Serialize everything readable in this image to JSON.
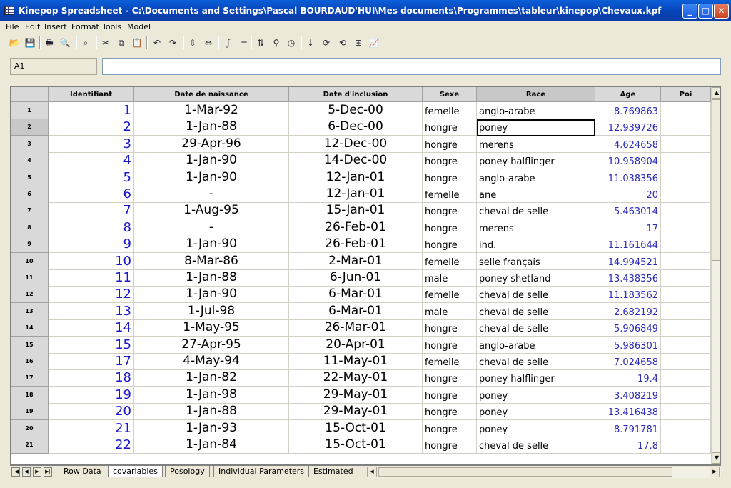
{
  "window": {
    "title": "Kinepop Spreadsheet - C:\\Documents and Settings\\Pascal BOURDAUD'HUI\\Mes documents\\Programmes\\tableur\\kinepop\\Chevaux.kpf",
    "minimize": "_",
    "maximize": "□",
    "close": "✕"
  },
  "menu": [
    "File",
    "Edit",
    "Insert",
    "Format",
    "Tools",
    "Model"
  ],
  "toolbar": [
    {
      "name": "open-icon",
      "glyph": "📂"
    },
    {
      "name": "save-icon",
      "glyph": "💾"
    },
    {
      "name": "print-icon",
      "glyph": "🖶"
    },
    {
      "name": "print-preview-icon",
      "glyph": "🔍"
    },
    {
      "name": "find-icon",
      "glyph": "⌕"
    },
    {
      "name": "cut-icon",
      "glyph": "✂"
    },
    {
      "name": "copy-icon",
      "glyph": "⧉"
    },
    {
      "name": "paste-icon",
      "glyph": "📋"
    },
    {
      "name": "undo-icon",
      "glyph": "↶"
    },
    {
      "name": "redo-icon",
      "glyph": "↷"
    },
    {
      "name": "insert-rows-icon",
      "glyph": "⇳"
    },
    {
      "name": "insert-columns-icon",
      "glyph": "⇔"
    },
    {
      "name": "function-icon",
      "glyph": "ƒ"
    },
    {
      "name": "equals-icon",
      "glyph": "="
    },
    {
      "name": "sort-icon",
      "glyph": "⇅"
    },
    {
      "name": "filter-icon",
      "glyph": "⚲"
    },
    {
      "name": "clock-icon",
      "glyph": "◷"
    },
    {
      "name": "sort-asc-icon",
      "glyph": "↓"
    },
    {
      "name": "rotate-icon",
      "glyph": "⟳"
    },
    {
      "name": "rotate-back-icon",
      "glyph": "⟲"
    },
    {
      "name": "grid-icon",
      "glyph": "⊞"
    },
    {
      "name": "chart-icon",
      "glyph": "📈"
    }
  ],
  "cell_ref": "A1",
  "formula_value": "",
  "columns": {
    "id": "Identifiant",
    "birth": "Date de naissance",
    "inclusion": "Date d'inclusion",
    "sexe": "Sexe",
    "race": "Race",
    "age": "Age",
    "po": "Poi"
  },
  "rows": [
    {
      "n": "1",
      "id": "1",
      "birth": "1-Mar-92",
      "inclusion": "5-Dec-00",
      "sexe": "femelle",
      "race": "anglo-arabe",
      "age": "8.769863"
    },
    {
      "n": "2",
      "id": "2",
      "birth": "1-Jan-88",
      "inclusion": "6-Dec-00",
      "sexe": "hongre",
      "race": "poney",
      "age": "12.939726"
    },
    {
      "n": "3",
      "id": "3",
      "birth": "29-Apr-96",
      "inclusion": "12-Dec-00",
      "sexe": "hongre",
      "race": "merens",
      "age": "4.624658"
    },
    {
      "n": "4",
      "id": "4",
      "birth": "1-Jan-90",
      "inclusion": "14-Dec-00",
      "sexe": "hongre",
      "race": "poney halflinger",
      "age": "10.958904"
    },
    {
      "n": "5",
      "id": "5",
      "birth": "1-Jan-90",
      "inclusion": "12-Jan-01",
      "sexe": "hongre",
      "race": "anglo-arabe",
      "age": "11.038356"
    },
    {
      "n": "6",
      "id": "6",
      "birth": "-",
      "inclusion": "12-Jan-01",
      "sexe": "femelle",
      "race": "ane",
      "age": "20"
    },
    {
      "n": "7",
      "id": "7",
      "birth": "1-Aug-95",
      "inclusion": "15-Jan-01",
      "sexe": "hongre",
      "race": "cheval de selle",
      "age": "5.463014"
    },
    {
      "n": "8",
      "id": "8",
      "birth": "-",
      "inclusion": "26-Feb-01",
      "sexe": "hongre",
      "race": "merens",
      "age": "17"
    },
    {
      "n": "9",
      "id": "9",
      "birth": "1-Jan-90",
      "inclusion": "26-Feb-01",
      "sexe": "hongre",
      "race": "ind.",
      "age": "11.161644"
    },
    {
      "n": "10",
      "id": "10",
      "birth": "8-Mar-86",
      "inclusion": "2-Mar-01",
      "sexe": "femelle",
      "race": "selle français",
      "age": "14.994521"
    },
    {
      "n": "11",
      "id": "11",
      "birth": "1-Jan-88",
      "inclusion": "6-Jun-01",
      "sexe": "male",
      "race": "poney shetland",
      "age": "13.438356"
    },
    {
      "n": "12",
      "id": "12",
      "birth": "1-Jan-90",
      "inclusion": "6-Mar-01",
      "sexe": "femelle",
      "race": "cheval de selle",
      "age": "11.183562"
    },
    {
      "n": "13",
      "id": "13",
      "birth": "1-Jul-98",
      "inclusion": "6-Mar-01",
      "sexe": "male",
      "race": "cheval de selle",
      "age": "2.682192"
    },
    {
      "n": "14",
      "id": "14",
      "birth": "1-May-95",
      "inclusion": "26-Mar-01",
      "sexe": "hongre",
      "race": "cheval de selle",
      "age": "5.906849"
    },
    {
      "n": "15",
      "id": "15",
      "birth": "27-Apr-95",
      "inclusion": "20-Apr-01",
      "sexe": "hongre",
      "race": "anglo-arabe",
      "age": "5.986301"
    },
    {
      "n": "16",
      "id": "17",
      "birth": "4-May-94",
      "inclusion": "11-May-01",
      "sexe": "femelle",
      "race": "cheval de selle",
      "age": "7.024658"
    },
    {
      "n": "17",
      "id": "18",
      "birth": "1-Jan-82",
      "inclusion": "22-May-01",
      "sexe": "hongre",
      "race": "poney halflinger",
      "age": "19.4"
    },
    {
      "n": "18",
      "id": "19",
      "birth": "1-Jan-98",
      "inclusion": "29-May-01",
      "sexe": "hongre",
      "race": "poney",
      "age": "3.408219"
    },
    {
      "n": "19",
      "id": "20",
      "birth": "1-Jan-88",
      "inclusion": "29-May-01",
      "sexe": "hongre",
      "race": "poney",
      "age": "13.416438"
    },
    {
      "n": "20",
      "id": "21",
      "birth": "1-Jan-93",
      "inclusion": "15-Oct-01",
      "sexe": "hongre",
      "race": "poney",
      "age": "8.791781"
    },
    {
      "n": "21",
      "id": "22",
      "birth": "1-Jan-84",
      "inclusion": "15-Oct-01",
      "sexe": "hongre",
      "race": "cheval de selle",
      "age": "17.8"
    }
  ],
  "sheet_tabs": [
    "Row Data",
    "covariables",
    "Posology",
    "Individual Parameters",
    "Estimated"
  ],
  "active_tab": "covariables",
  "nav_buttons": [
    "|◀",
    "◀",
    "▶",
    "▶|"
  ],
  "scroll_glyphs": {
    "up": "▲",
    "down": "▼",
    "left": "◀",
    "right": "▶"
  }
}
